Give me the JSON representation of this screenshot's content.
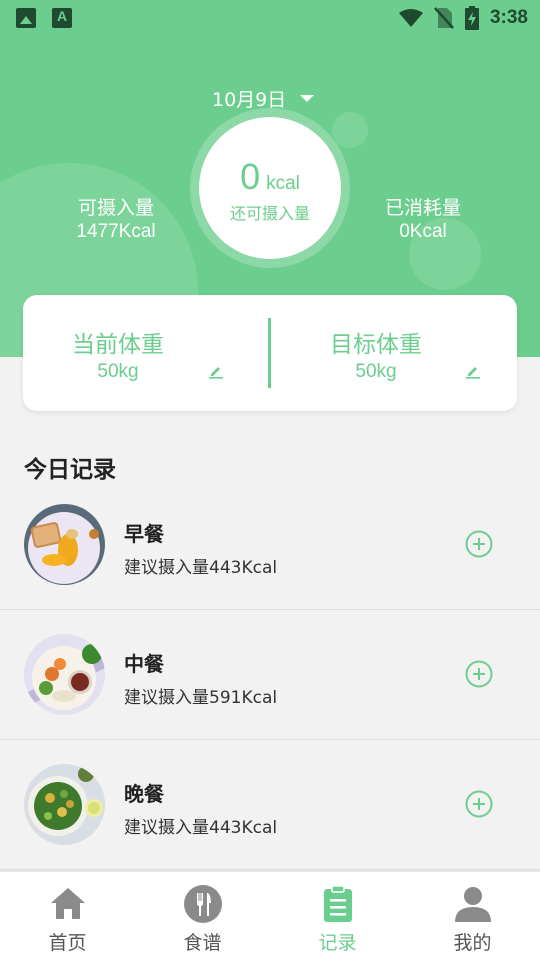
{
  "status_bar": {
    "time": "3:38"
  },
  "header": {
    "date": "10月9日",
    "center": {
      "value": "0",
      "unit": "kcal",
      "label": "还可摄入量"
    },
    "left_stat": {
      "label": "可摄入量",
      "value": "1477Kcal"
    },
    "right_stat": {
      "label": "已消耗量",
      "value": "0Kcal"
    }
  },
  "weight": {
    "current": {
      "label": "当前体重",
      "value": "50kg"
    },
    "target": {
      "label": "目标体重",
      "value": "50kg"
    }
  },
  "records": {
    "title": "今日记录",
    "meals": [
      {
        "name": "早餐",
        "suggestion": "建议摄入量443Kcal"
      },
      {
        "name": "中餐",
        "suggestion": "建议摄入量591Kcal"
      },
      {
        "name": "晚餐",
        "suggestion": "建议摄入量443Kcal"
      }
    ]
  },
  "nav": {
    "items": [
      {
        "label": "首页",
        "icon": "home-icon"
      },
      {
        "label": "食谱",
        "icon": "utensils-icon"
      },
      {
        "label": "记录",
        "icon": "clipboard-icon"
      },
      {
        "label": "我的",
        "icon": "user-icon"
      }
    ],
    "active_index": 2
  },
  "colors": {
    "accent": "#6cce8e",
    "background": "#f2f2f2",
    "nav_inactive": "#8a8a8a"
  }
}
